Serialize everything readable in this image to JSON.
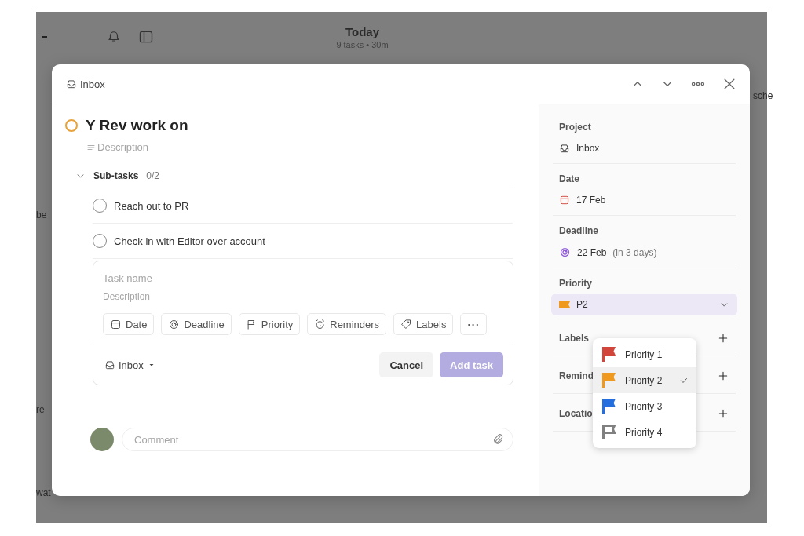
{
  "app": {
    "title": "Today",
    "subtitle": "9 tasks • 30m",
    "fragments": [
      {
        "text": "be"
      },
      {
        "text": "re"
      },
      {
        "text": "wat"
      },
      {
        "text": "sche"
      }
    ]
  },
  "modal": {
    "project": "Inbox"
  },
  "task": {
    "title": "Y Rev work on",
    "checked": false,
    "color": "#e8a33a",
    "description": {
      "placeholder": "Description"
    }
  },
  "subtasks": {
    "label": "Sub-tasks",
    "count": "0/2",
    "expanded": true,
    "items": [
      {
        "name": "Reach out to PR",
        "checked": false
      },
      {
        "name": "Check in with Editor over account",
        "checked": false
      }
    ]
  },
  "add_form": {
    "task_name": {
      "placeholder": "Task name"
    },
    "description": {
      "placeholder": "Description"
    },
    "chips": [
      {
        "label": "Date"
      },
      {
        "label": "Deadline"
      },
      {
        "label": "Priority"
      },
      {
        "label": "Reminders"
      },
      {
        "label": "Labels"
      }
    ],
    "more": "···",
    "project": "Inbox",
    "cancel": "Cancel",
    "submit": {
      "label": "Add task",
      "disabled": true
    }
  },
  "comment": {
    "placeholder": "Comment"
  },
  "sidebar": [
    {
      "kind": "project",
      "label": "Project",
      "value": "Inbox"
    },
    {
      "kind": "date",
      "label": "Date",
      "value": "17 Feb"
    },
    {
      "kind": "deadline",
      "label": "Deadline",
      "value": "22 Feb",
      "note": "(in 3 days)"
    },
    {
      "kind": "priority",
      "label": "Priority",
      "value": "P2",
      "color": "#ef9a1e"
    },
    {
      "kind": "add",
      "label": "Labels"
    },
    {
      "kind": "add",
      "label": "Remind"
    },
    {
      "kind": "add",
      "label": "Locatio"
    }
  ],
  "priority_menu": [
    {
      "label": "Priority 1",
      "color": "#d1453b",
      "selected": false
    },
    {
      "label": "Priority 2",
      "color": "#ef9a1e",
      "selected": true
    },
    {
      "label": "Priority 3",
      "color": "#246fe0",
      "selected": false
    },
    {
      "label": "Priority 4",
      "color": "#808080",
      "selected": false
    }
  ]
}
